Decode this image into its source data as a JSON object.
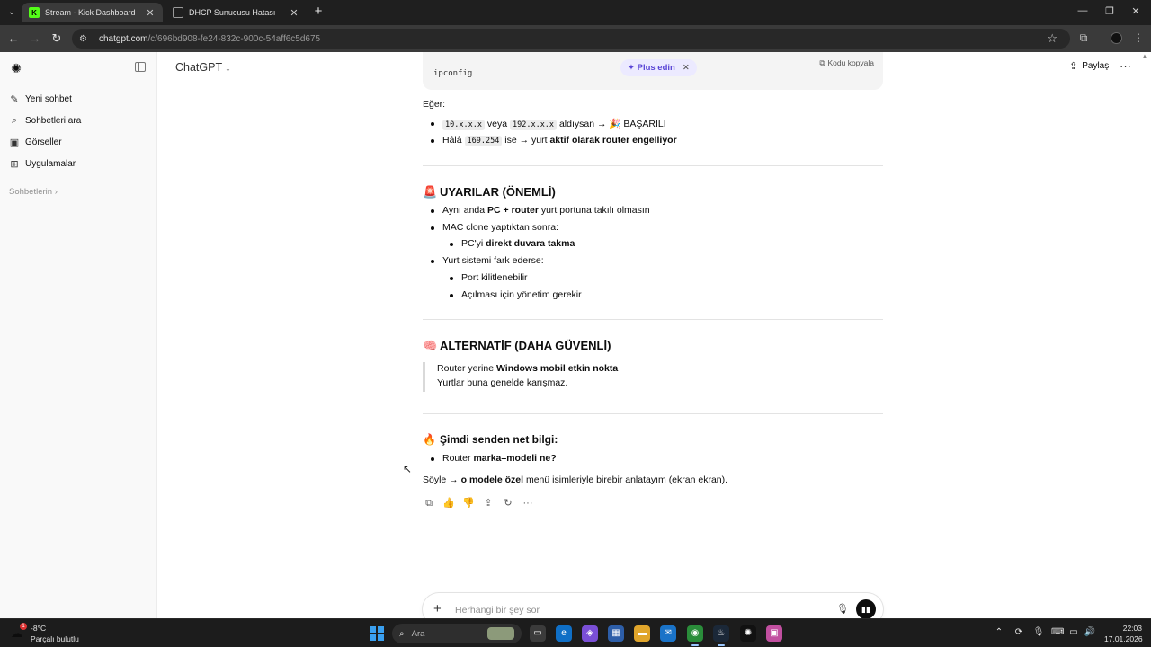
{
  "browser": {
    "tabs": [
      {
        "title": "Stream - Kick Dashboard",
        "favicon": "kick-logo-icon",
        "active": true
      },
      {
        "title": "DHCP Sunucusu Hatası",
        "favicon": "chatgpt-logo-icon",
        "active": false
      }
    ],
    "url_host": "chatgpt.com",
    "url_path": "/c/696bd908-fe24-832c-900c-54aff6c5d675"
  },
  "sidebar": {
    "items": [
      {
        "label": "Yeni sohbet",
        "icon": "edit-icon"
      },
      {
        "label": "Sohbetleri ara",
        "icon": "search-icon"
      },
      {
        "label": "Görseller",
        "icon": "image-icon"
      },
      {
        "label": "Uygulamalar",
        "icon": "apps-grid-icon"
      }
    ],
    "section_label": "Sohbetlerin"
  },
  "header": {
    "model": "ChatGPT",
    "share_label": "Paylaş",
    "plus_label": "Plus edin"
  },
  "codeblock": {
    "code": "ipconfig",
    "copy_label": "Kodu kopyala"
  },
  "message": {
    "if_label": "Eğer:",
    "b1_code1": "10.x.x.x",
    "b1_mid": "veya",
    "b1_code2": "192.x.x.x",
    "b1_rest": "aldıysan →",
    "b1_emoji": "🎉",
    "b1_end": "BAŞARILI",
    "b2_pre": "Hâlâ",
    "b2_code": "169.254",
    "b2_mid": "ise → yurt",
    "b2_bold": "aktif olarak router engelliyor",
    "warn_emoji": "🚨",
    "warn_title": "UYARILAR (ÖNEMLİ)",
    "w1_pre": "Aynı anda",
    "w1_bold": "PC + router",
    "w1_rest": "yurt portuna takılı olmasın",
    "w2": "MAC clone yaptıktan sonra:",
    "w2a_pre": "PC'yi",
    "w2a_bold": "direkt duvara takma",
    "w3": "Yurt sistemi fark ederse:",
    "w3a": "Port kilitlenebilir",
    "w3b": "Açılması için yönetim gerekir",
    "alt_emoji": "🧠",
    "alt_title": "ALTERNATİF (DAHA GÜVENLİ)",
    "q1_pre": "Router yerine",
    "q1_bold": "Windows mobil etkin nokta",
    "q2": "Yurtlar buna genelde karışmaz.",
    "now_emoji": "🔥",
    "now_title": "Şimdi senden net bilgi:",
    "n1_pre": "Router",
    "n1_bold": "marka–modeli ne?",
    "say_pre": "Söyle →",
    "say_bold": "o modele özel",
    "say_rest": "menü isimleriyle birebir anlatayım (ekran ekran)."
  },
  "composer": {
    "placeholder": "Herhangi bir şey sor"
  },
  "taskbar": {
    "weather_temp": "-8°C",
    "weather_desc": "Parçalı bulutlu",
    "weather_badge": "1",
    "search_label": "Ara",
    "time": "22:03",
    "date": "17.01.2026"
  },
  "colors": {
    "accent_plus": "#5a45d6",
    "kick_green": "#53fc18",
    "chrome_dark": "#1f1f1f"
  }
}
